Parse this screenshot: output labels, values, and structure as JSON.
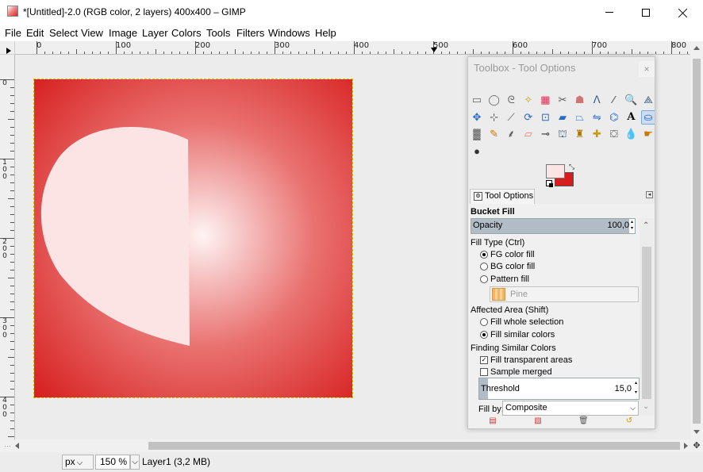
{
  "window": {
    "title": "*[Untitled]-2.0 (RGB color, 2 layers) 400x400 – GIMP"
  },
  "menu": [
    "File",
    "Edit",
    "Select",
    "View",
    "Image",
    "Layer",
    "Colors",
    "Tools",
    "Filters",
    "Windows",
    "Help"
  ],
  "ruler": {
    "horizontal": [
      "0",
      "100",
      "200",
      "300",
      "400",
      "500",
      "600",
      "700",
      "800"
    ],
    "vertical": [
      "0",
      "100",
      "200",
      "300",
      "400"
    ]
  },
  "colors": {
    "foreground": "#fbe4e4",
    "background": "#d61c1c",
    "image_edge": "#d61e1e",
    "image_center": "#fff4f4"
  },
  "status": {
    "unit": "px",
    "zoom": "150 %",
    "layer_info": "Layer1 (3,2 MB)"
  },
  "dock": {
    "title": "Toolbox - Tool Options",
    "close_label": "×",
    "tab_label": "Tool Options",
    "tools": [
      "rect-select-icon",
      "ellipse-select-icon",
      "free-select-icon",
      "fuzzy-select-icon",
      "color-select-icon",
      "scissors-icon",
      "foreground-select-icon",
      "paths-icon",
      "color-picker-icon",
      "zoom-icon",
      "measure-icon",
      "move-icon",
      "align-icon",
      "crop-icon",
      "rotate-icon",
      "scale-icon",
      "shear-icon",
      "perspective-icon",
      "flip-icon",
      "cage-icon",
      "text-icon",
      "bucket-fill-icon",
      "blend-icon",
      "pencil-icon",
      "paintbrush-icon",
      "eraser-icon",
      "airbrush-icon",
      "ink-icon",
      "clone-icon",
      "heal-icon",
      "perspective-clone-icon",
      "blur-icon",
      "smudge-icon",
      "dodge-burn-icon"
    ]
  },
  "options": {
    "tool_name": "Bucket Fill",
    "opacity_label": "Opacity",
    "opacity_value": "100,0",
    "fill_type_label": "Fill Type  (Ctrl)",
    "fill_type_options": [
      "FG color fill",
      "BG color fill",
      "Pattern fill"
    ],
    "fill_type_selected": "FG color fill",
    "pattern_name": "Pine",
    "affected_area_label": "Affected Area  (Shift)",
    "affected_area_options": [
      "Fill whole selection",
      "Fill similar colors"
    ],
    "affected_area_selected": "Fill similar colors",
    "finding_label": "Finding Similar Colors",
    "fill_transparent_label": "Fill transparent areas",
    "fill_transparent_checked": true,
    "sample_merged_label": "Sample merged",
    "sample_merged_checked": false,
    "threshold_label": "Threshold",
    "threshold_value": "15,0",
    "fill_by_label": "Fill by:",
    "fill_by_value": "Composite"
  }
}
